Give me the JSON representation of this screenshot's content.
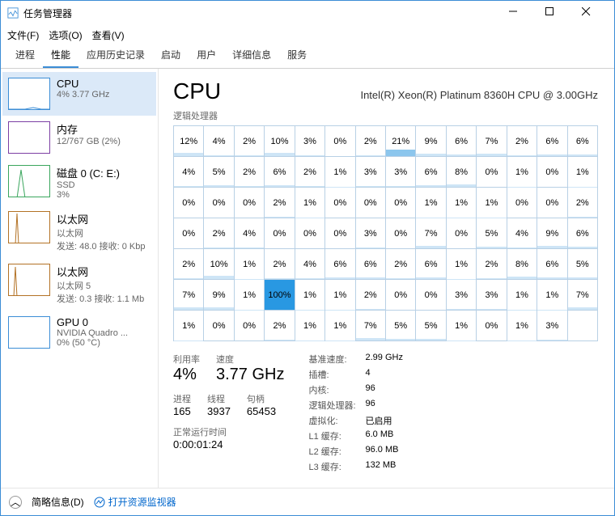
{
  "window": {
    "title": "任务管理器"
  },
  "menu": {
    "file": "文件(F)",
    "options": "选项(O)",
    "view": "查看(V)"
  },
  "tabs": {
    "processes": "进程",
    "performance": "性能",
    "apphistory": "应用历史记录",
    "startup": "启动",
    "users": "用户",
    "details": "详细信息",
    "services": "服务"
  },
  "sidebar": {
    "items": [
      {
        "name": "CPU",
        "desc": "4% 3.77 GHz"
      },
      {
        "name": "内存",
        "desc": "12/767 GB (2%)"
      },
      {
        "name": "磁盘 0 (C: E:)",
        "desc": "SSD",
        "desc2": "3%"
      },
      {
        "name": "以太网",
        "desc": "以太网",
        "desc2": "发送: 48.0 接收: 0 Kbp"
      },
      {
        "name": "以太网",
        "desc": "以太网 5",
        "desc2": "发送: 0.3 接收: 1.1 Mb"
      },
      {
        "name": "GPU 0",
        "desc": "NVIDIA Quadro ...",
        "desc2": "0% (50 °C)"
      }
    ]
  },
  "main": {
    "title": "CPU",
    "model": "Intel(R) Xeon(R) Platinum 8360H CPU @ 3.00GHz",
    "subtitle": "逻辑处理器",
    "cores": [
      [
        12,
        4,
        2,
        10,
        3,
        0,
        2,
        21,
        9,
        6,
        7,
        2,
        6,
        6
      ],
      [
        4,
        5,
        2,
        6,
        2,
        1,
        3,
        3,
        6,
        8,
        0,
        1,
        0,
        1
      ],
      [
        0,
        0,
        0,
        2,
        1,
        0,
        0,
        0,
        1,
        1,
        1,
        0,
        0,
        2
      ],
      [
        0,
        2,
        4,
        0,
        0,
        0,
        3,
        0,
        7,
        0,
        5,
        4,
        9,
        6
      ],
      [
        2,
        10,
        1,
        2,
        4,
        6,
        6,
        2,
        6,
        1,
        2,
        8,
        6,
        5
      ],
      [
        7,
        9,
        1,
        100,
        1,
        1,
        2,
        0,
        0,
        3,
        3,
        1,
        1,
        7
      ],
      [
        1,
        0,
        0,
        2,
        1,
        1,
        7,
        5,
        5,
        1,
        0,
        1,
        3,
        null
      ]
    ],
    "stats": {
      "util_label": "利用率",
      "util": "4%",
      "speed_label": "速度",
      "speed": "3.77 GHz",
      "procs_label": "进程",
      "procs": "165",
      "threads_label": "线程",
      "threads": "3937",
      "handles_label": "句柄",
      "handles": "65453",
      "uptime_label": "正常运行时间",
      "uptime": "0:00:01:24"
    },
    "kv": {
      "basespeed_l": "基准速度:",
      "basespeed_v": "2.99 GHz",
      "sockets_l": "插槽:",
      "sockets_v": "4",
      "cores_l": "内核:",
      "cores_v": "96",
      "logical_l": "逻辑处理器:",
      "logical_v": "96",
      "virt_l": "虚拟化:",
      "virt_v": "已启用",
      "l1_l": "L1 缓存:",
      "l1_v": "6.0 MB",
      "l2_l": "L2 缓存:",
      "l2_v": "96.0 MB",
      "l3_l": "L3 缓存:",
      "l3_v": "132 MB"
    }
  },
  "footer": {
    "fewer": "简略信息(D)",
    "monitor": "打开资源监视器"
  }
}
